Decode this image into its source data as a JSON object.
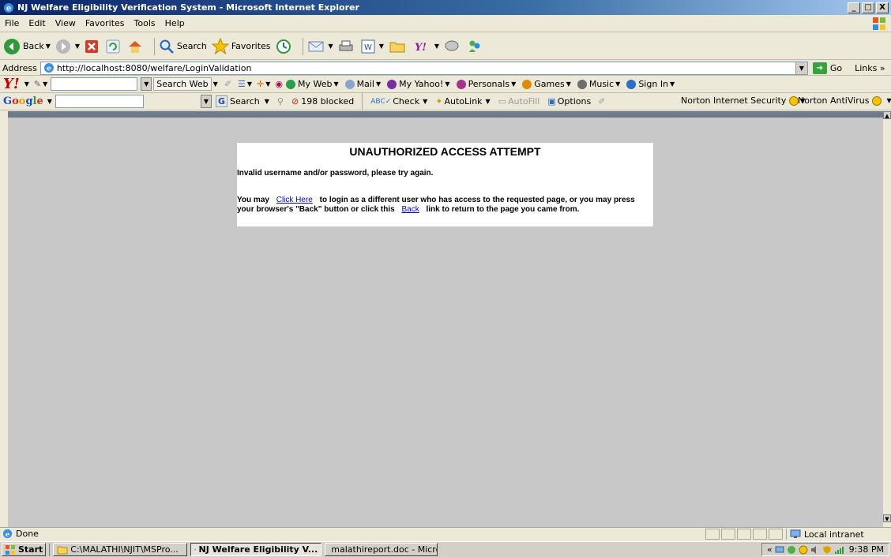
{
  "window": {
    "title": "NJ Welfare Eligibility Verification System - Microsoft Internet Explorer",
    "min": "_",
    "max": "□",
    "close": "X"
  },
  "menu": [
    "File",
    "Edit",
    "View",
    "Favorites",
    "Tools",
    "Help"
  ],
  "toolbar": {
    "back": "Back",
    "search": "Search",
    "favorites": "Favorites"
  },
  "address": {
    "label": "Address",
    "url": "http://localhost:8080/welfare/LoginValidation",
    "go": "Go",
    "links": "Links"
  },
  "yahoo": {
    "search_web": "Search Web",
    "items": [
      "My Web",
      "Mail",
      "My Yahoo!",
      "Personals",
      "Games",
      "Music",
      "Sign In"
    ]
  },
  "google": {
    "search": "Search",
    "blocked": "198 blocked",
    "check": "Check",
    "autolink": "AutoLink",
    "autofill": "AutoFill",
    "options": "Options"
  },
  "norton": {
    "security": "Norton Internet Security",
    "antivirus": "Norton AntiVirus"
  },
  "page": {
    "heading": "UNAUTHORIZED ACCESS ATTEMPT",
    "error": "Invalid username and/or password, please try again.",
    "msg_1": "You may",
    "link_click_here": "Click Here",
    "msg_2": "to login as a different user who has access to the requested page, or you may press your browser's \"Back\" button or click this",
    "link_back": "Back",
    "msg_3": "link to return to the page you came from."
  },
  "status": {
    "text": "Done",
    "zone": "Local intranet"
  },
  "taskbar": {
    "start": "Start",
    "tasks": [
      "C:\\MALATHI\\NJIT\\MSPro...",
      "NJ Welfare Eligibility V...",
      "malathireport.doc - Micro..."
    ],
    "clock": "9:38 PM"
  }
}
